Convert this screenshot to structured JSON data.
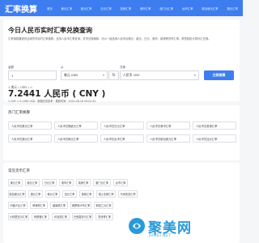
{
  "header": {
    "logo": "汇率换算",
    "nav": [
      "首页",
      "美元汇率",
      "欧元汇率",
      "日元汇率",
      "英镑汇率",
      "港币汇率",
      "澳门元汇率",
      "台币汇率",
      "新加坡元汇率",
      "澳元汇率"
    ]
  },
  "converter": {
    "title": "今日人民币实时汇率兑换查询",
    "description": "汇率换算器提供全球货币实时汇率换算，支持人民币汇率查询，货币兑换换算，可以一键查询人民币对美元、欧元、日元、港币、英镑等货币汇率，帮您轻松计算外汇兑换。",
    "amount_label": "金额",
    "from_label": "从",
    "to_label": "兑换",
    "amount_value": "1",
    "from_value": "美元 USD",
    "to_value": "人民币 CNY",
    "swap_icon": "swap-icon",
    "button_label": "立即换算",
    "result_line": "1 美元 ( USD ) =",
    "result_value": "7.2441 人民币 ( CNY )",
    "result_sub": "1 CNY = 0.1380 USD · 数据仅供参考 · 更新时间：2024-06-18 09:02:42"
  },
  "hot": {
    "title": "热门汇率换算",
    "items": [
      "人民币兑美元汇率",
      "人民币兑换欧元汇率",
      "人民币兑日元汇率",
      "人民币兑港币汇率",
      "人民币兑英镑汇率",
      "人民币兑澳元汇率",
      "人民币兑韩元汇率",
      "人民币兑台币汇率",
      "人民币兑新加坡元汇率",
      "人民币兑加元汇率"
    ]
  },
  "currencies": {
    "title": "常见货币汇率",
    "items": [
      "美元汇率",
      "欧元汇率",
      "日元汇率",
      "港币汇率",
      "英镑汇率",
      "澳门元汇率",
      "台币汇率",
      "新加坡元汇率",
      "澳元汇率",
      "韩元汇率",
      "加元汇率",
      "泰铢汇率",
      "瑞士法郎汇率",
      "马来西亚汇率",
      "印度卢比汇率",
      "菲律宾汇率",
      "越南盾汇率",
      "俄罗斯卢布汇率",
      "新西兰元汇率",
      "沙特里亚尔汇率",
      "阿联酋汇率",
      "印尼盾汇率",
      "巴西雷亚尔汇率",
      "墨西哥汇率"
    ]
  },
  "watermark": {
    "text": "聚美网",
    "sub": "JUMEI.NET"
  }
}
